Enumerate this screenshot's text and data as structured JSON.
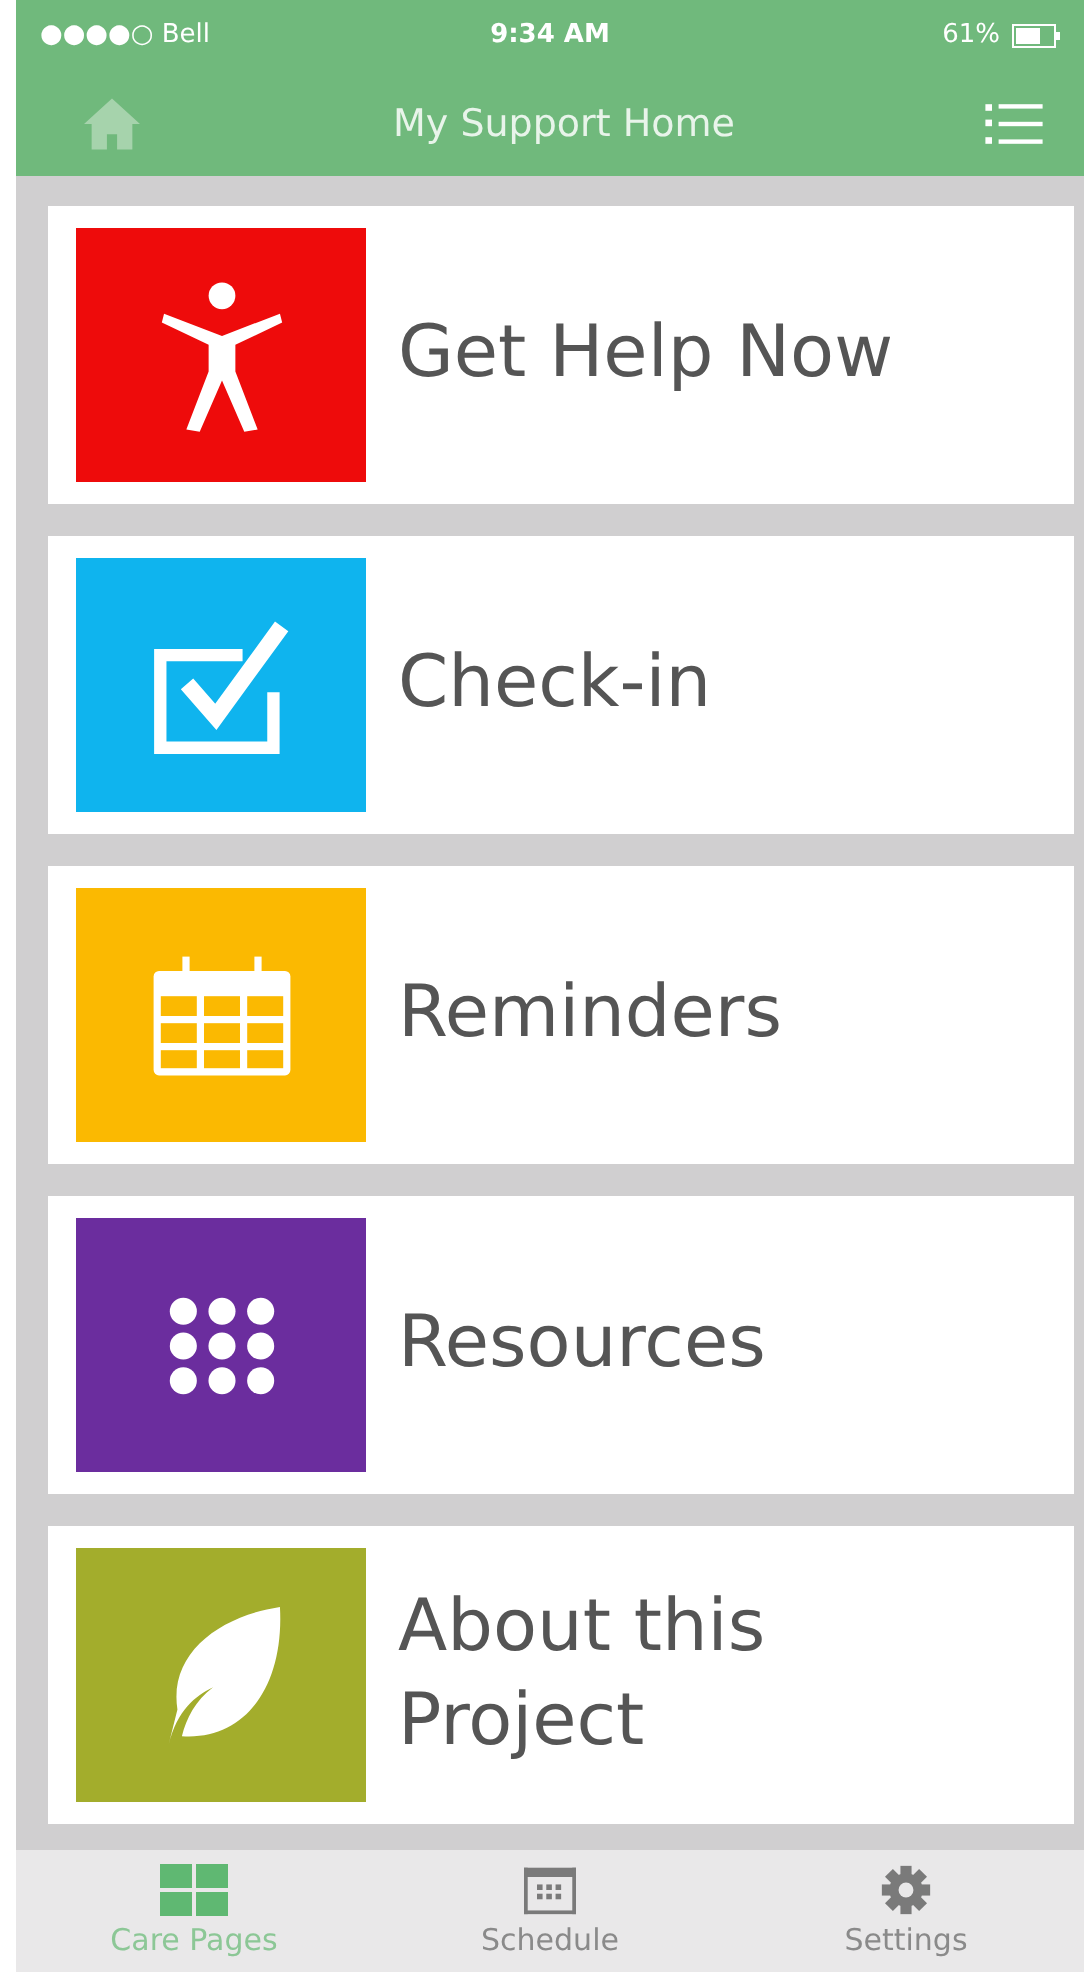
{
  "status_bar": {
    "carrier": "●●●●○ Bell",
    "time": "9:34 AM",
    "battery": "61%"
  },
  "nav_bar": {
    "title": "My Support Home"
  },
  "menu_items": [
    {
      "label": "Get Help Now",
      "kind": "person",
      "color": "#ee0b0b"
    },
    {
      "label": "Check-in",
      "kind": "check",
      "color": "#0fb4ee"
    },
    {
      "label": "Reminders",
      "kind": "calendar",
      "color": "#fbb901"
    },
    {
      "label": "Resources",
      "kind": "dots",
      "color": "#6b2d9e"
    },
    {
      "label": "About this Project",
      "kind": "leaf",
      "color": "#a3ad2c"
    }
  ],
  "tab_bar": [
    {
      "label": "Care Pages",
      "kind": "grid",
      "selected": true
    },
    {
      "label": "Schedule",
      "kind": "calendar",
      "selected": false
    },
    {
      "label": "Settings",
      "kind": "gear",
      "selected": false
    }
  ]
}
